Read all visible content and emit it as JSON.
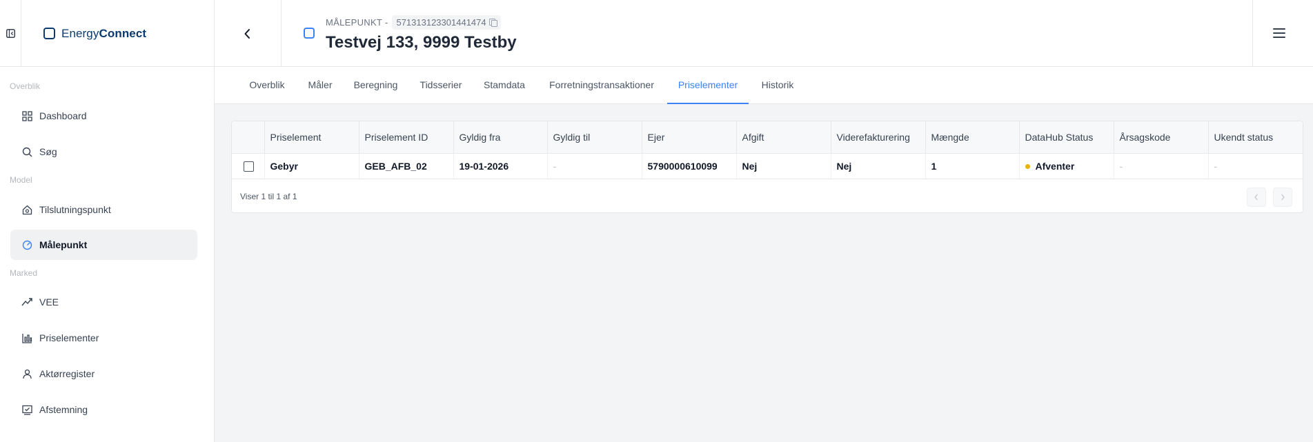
{
  "brand": {
    "name_light": "Energy",
    "name_bold": "Connect"
  },
  "header": {
    "subtitle_label": "MÅLEPUNKT -",
    "metering_point_id": "571313123301441474",
    "title": "Testvej 133, 9999 Testby"
  },
  "sidebar": {
    "sections": [
      {
        "label": "Overblik"
      },
      {
        "label": "Model"
      },
      {
        "label": "Marked"
      }
    ],
    "items": [
      {
        "label": "Dashboard",
        "icon": "grid-icon"
      },
      {
        "label": "Søg",
        "icon": "search-icon"
      },
      {
        "label": "Tilslutningspunkt",
        "icon": "house-plug-icon"
      },
      {
        "label": "Målepunkt",
        "icon": "gauge-icon",
        "active": true
      },
      {
        "label": "VEE",
        "icon": "trend-icon"
      },
      {
        "label": "Priselementer",
        "icon": "bar-chart-icon"
      },
      {
        "label": "Aktørregister",
        "icon": "user-icon"
      },
      {
        "label": "Afstemning",
        "icon": "check-monitor-icon"
      }
    ]
  },
  "tabs": [
    {
      "label": "Overblik"
    },
    {
      "label": "Måler"
    },
    {
      "label": "Beregning"
    },
    {
      "label": "Tidsserier"
    },
    {
      "label": "Stamdata"
    },
    {
      "label": "Forretningstransaktioner"
    },
    {
      "label": "Priselementer",
      "active": true
    },
    {
      "label": "Historik"
    }
  ],
  "table": {
    "columns": [
      "Priselement",
      "Priselement ID",
      "Gyldig fra",
      "Gyldig til",
      "Ejer",
      "Afgift",
      "Viderefakturering",
      "Mængde",
      "DataHub Status",
      "Årsagskode",
      "Ukendt status"
    ],
    "rows": [
      {
        "priselement": "Gebyr",
        "id": "GEB_AFB_02",
        "gyldig_fra": "19-01-2026",
        "gyldig_til": "-",
        "ejer": "5790000610099",
        "afgift": "Nej",
        "viderefakturering": "Nej",
        "maengde": "1",
        "datahub_status": "Afventer",
        "aarsagskode": "-",
        "ukendt_status": "-"
      }
    ],
    "footer": "Viser 1 til 1 af 1"
  },
  "colors": {
    "accent": "#3b82f6",
    "brand": "#0b3a6e",
    "status_pending": "#eab308"
  }
}
